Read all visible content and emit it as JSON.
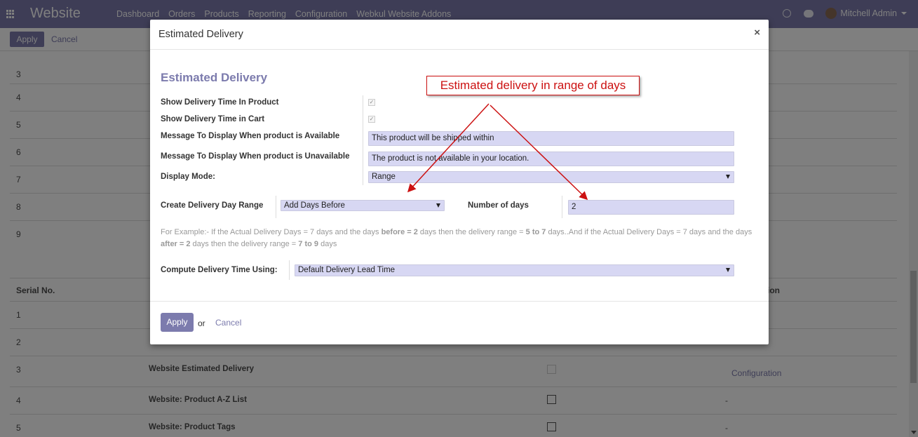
{
  "navbar": {
    "app_name": "Website",
    "menu": [
      "Dashboard",
      "Orders",
      "Products",
      "Reporting",
      "Configuration",
      "Webkul Website Addons"
    ],
    "user": "Mitchell Admin"
  },
  "control_panel": {
    "apply": "Apply",
    "cancel": "Cancel"
  },
  "background_rows_top": [
    "3",
    "4",
    "5",
    "6",
    "7",
    "8",
    "9"
  ],
  "background_table": {
    "header_serial": "Serial No.",
    "header_right_partial": "ion",
    "rows": [
      {
        "serial": "1",
        "name": "",
        "checked": null,
        "right": ""
      },
      {
        "serial": "2",
        "name": "",
        "checked": null,
        "right": ""
      },
      {
        "serial": "3",
        "name": "Website Estimated Delivery",
        "checked": true,
        "right": "Configuration"
      },
      {
        "serial": "4",
        "name": "Website: Product A-Z List",
        "checked": false,
        "right": "-"
      },
      {
        "serial": "5",
        "name": "Website: Product Tags",
        "checked": false,
        "right": "-"
      }
    ]
  },
  "modal": {
    "title": "Estimated Delivery",
    "section_title": "Estimated Delivery",
    "fields": {
      "show_in_product": {
        "label": "Show Delivery Time In Product",
        "checked": true
      },
      "show_in_cart": {
        "label": "Show Delivery Time in Cart",
        "checked": true
      },
      "msg_available": {
        "label": "Message To Display When product is Available",
        "value": "This product will be shipped within"
      },
      "msg_unavailable": {
        "label": "Message To Display When product is Unavailable",
        "value": "The product is not available in your location."
      },
      "display_mode": {
        "label": "Display Mode:",
        "value": "Range"
      },
      "day_range": {
        "label": "Create Delivery Day Range",
        "value": "Add Days Before"
      },
      "number_of_days": {
        "label": "Number of days",
        "value": "2"
      },
      "compute_using": {
        "label": "Compute Delivery Time Using:",
        "value": "Default Delivery Lead Time"
      }
    },
    "help": {
      "p1": "For Example:- If the Actual Delivery Days = 7 days and the days ",
      "b1": "before = 2",
      "p2": " days then the delivery range = ",
      "b2": "5 to 7",
      "p3": " days..And if the Actual Delivery Days = 7 days and the days ",
      "b3": "after = 2",
      "p4": " days then the delivery range = ",
      "b4": "7 to 9",
      "p5": " days"
    },
    "footer": {
      "apply": "Apply",
      "or": "or",
      "cancel": "Cancel"
    }
  },
  "annotation": {
    "text": "Estimated delivery in range of days",
    "color": "#cc1111"
  },
  "colors": {
    "brand": "#7c7bad",
    "input_bg": "#d7d7f3"
  }
}
